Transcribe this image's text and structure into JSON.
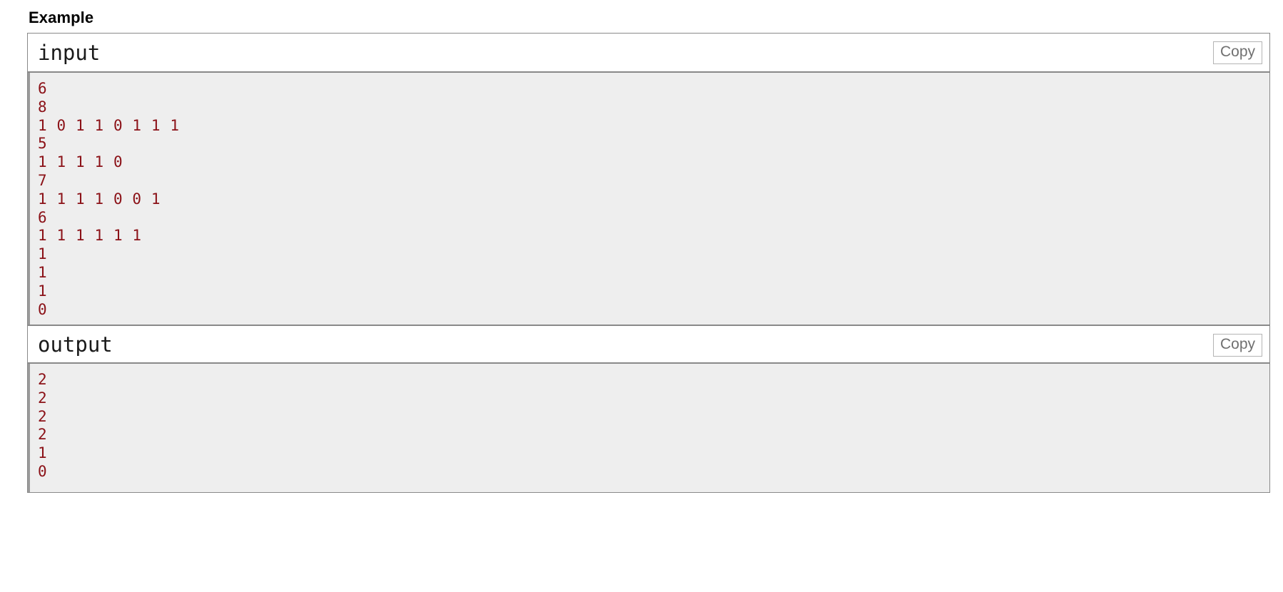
{
  "page": {
    "section_title": "Example",
    "accent_text_color": "#8b1117",
    "content_background": "#eeeeee",
    "border_color": "#898989"
  },
  "sample_tests": [
    {
      "input": {
        "label": "input",
        "copy_label": "Copy",
        "lines": [
          "6",
          "8",
          "1 0 1 1 0 1 1 1",
          "5",
          "1 1 1 1 0",
          "7",
          "1 1 1 1 0 0 1",
          "6",
          "1 1 1 1 1 1",
          "1",
          "1",
          "1",
          "0"
        ]
      },
      "output": {
        "label": "output",
        "copy_label": "Copy",
        "lines": [
          "2",
          "2",
          "2",
          "2",
          "1",
          "0"
        ]
      }
    }
  ]
}
